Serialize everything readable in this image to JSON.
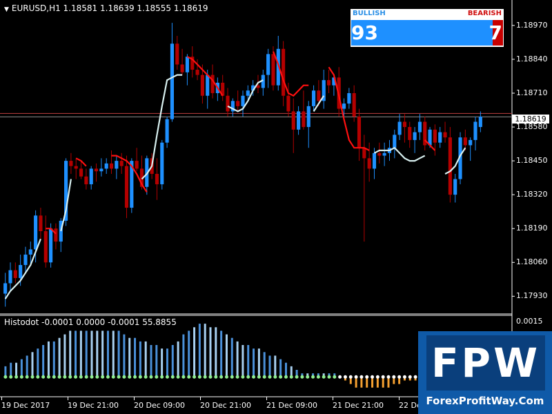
{
  "header": {
    "title": "EURUSD,H1  1.18581 1.18639 1.18555 1.18619"
  },
  "sub_window": {
    "title": "Histodot -0.0001 0.0000 -0.0001 55.8855",
    "ytick": "0.0015"
  },
  "y_axis": {
    "ticks": [
      "1.18970",
      "1.18840",
      "1.18710",
      "1.18580",
      "1.18450",
      "1.18320",
      "1.18190",
      "1.18060",
      "1.17930"
    ],
    "current_price": "1.18619"
  },
  "x_axis": {
    "ticks": [
      "19 Dec 2017",
      "19 Dec 21:00",
      "20 Dec 09:00",
      "20 Dec 21:00",
      "21 Dec 09:00",
      "21 Dec 21:00",
      "22 Dec"
    ]
  },
  "sentiment_panel": {
    "bullish_label": "BULLISH",
    "bearish_label": "BEARISH",
    "bullish_value": "93",
    "bearish_value": "7",
    "bullish_pct": 93,
    "bearish_pct": 7
  },
  "watermark": {
    "letters": "FPW",
    "url": "ForexProfitWay.Com"
  },
  "colors": {
    "background": "#000000",
    "bull_candle": "#1e90ff",
    "bear_candle": "#b40000",
    "line_up": "#d8f0f0",
    "line_down": "#ff1010",
    "histo_blue": "#4a90d9",
    "histo_light": "#a8d0f0",
    "histo_orange": "#f5a030",
    "dot_green": "#90ee90",
    "dot_white": "#ffffff",
    "grid_red": "#c04040"
  },
  "chart_data": {
    "type": "candlestick",
    "symbol": "EURUSD",
    "timeframe": "H1",
    "ylim": [
      1.1787,
      1.1902
    ],
    "ohlc": [
      [
        1.1794,
        1.1802,
        1.1789,
        1.1798
      ],
      [
        1.1798,
        1.1806,
        1.1795,
        1.1803
      ],
      [
        1.1803,
        1.1806,
        1.1798,
        1.18
      ],
      [
        1.18,
        1.1809,
        1.1797,
        1.1805
      ],
      [
        1.1805,
        1.1812,
        1.1802,
        1.1809
      ],
      [
        1.1809,
        1.1814,
        1.1805,
        1.1811
      ],
      [
        1.1811,
        1.1826,
        1.1806,
        1.1824
      ],
      [
        1.1824,
        1.1827,
        1.1815,
        1.1818
      ],
      [
        1.1818,
        1.1824,
        1.1804,
        1.1806
      ],
      [
        1.1806,
        1.1821,
        1.1804,
        1.1819
      ],
      [
        1.1819,
        1.1821,
        1.1811,
        1.1814
      ],
      [
        1.1814,
        1.1823,
        1.181,
        1.1822
      ],
      [
        1.1822,
        1.1846,
        1.182,
        1.1845
      ],
      [
        1.1845,
        1.1848,
        1.184,
        1.1843
      ],
      [
        1.1843,
        1.1846,
        1.1838,
        1.1842
      ],
      [
        1.1842,
        1.1845,
        1.1838,
        1.1839
      ],
      [
        1.1839,
        1.1842,
        1.1834,
        1.1836
      ],
      [
        1.1836,
        1.1843,
        1.1834,
        1.1842
      ],
      [
        1.1842,
        1.1844,
        1.1837,
        1.1841
      ],
      [
        1.1841,
        1.1846,
        1.1839,
        1.1842
      ],
      [
        1.1842,
        1.1846,
        1.184,
        1.1844
      ],
      [
        1.1844,
        1.1849,
        1.184,
        1.1842
      ],
      [
        1.1842,
        1.1847,
        1.1838,
        1.1845
      ],
      [
        1.1845,
        1.1848,
        1.184,
        1.1843
      ],
      [
        1.1843,
        1.1847,
        1.1823,
        1.1827
      ],
      [
        1.1827,
        1.1846,
        1.1825,
        1.1845
      ],
      [
        1.1845,
        1.185,
        1.1841,
        1.1842
      ],
      [
        1.1842,
        1.1847,
        1.1834,
        1.1835
      ],
      [
        1.1835,
        1.1847,
        1.1832,
        1.1846
      ],
      [
        1.1846,
        1.1848,
        1.1838,
        1.184
      ],
      [
        1.184,
        1.1846,
        1.183,
        1.1836
      ],
      [
        1.1836,
        1.1853,
        1.1834,
        1.1852
      ],
      [
        1.1852,
        1.1862,
        1.185,
        1.1861
      ],
      [
        1.1861,
        1.1898,
        1.186,
        1.189
      ],
      [
        1.189,
        1.1893,
        1.188,
        1.1882
      ],
      [
        1.1882,
        1.1888,
        1.1878,
        1.1879
      ],
      [
        1.1879,
        1.1886,
        1.1874,
        1.1885
      ],
      [
        1.1885,
        1.1889,
        1.1877,
        1.188
      ],
      [
        1.188,
        1.1884,
        1.1876,
        1.1878
      ],
      [
        1.1878,
        1.1882,
        1.1867,
        1.187
      ],
      [
        1.187,
        1.188,
        1.1865,
        1.1878
      ],
      [
        1.1878,
        1.1882,
        1.1869,
        1.1871
      ],
      [
        1.1871,
        1.1877,
        1.1868,
        1.1875
      ],
      [
        1.1875,
        1.1878,
        1.1868,
        1.187
      ],
      [
        1.187,
        1.1873,
        1.1862,
        1.1864
      ],
      [
        1.1864,
        1.1869,
        1.1862,
        1.1868
      ],
      [
        1.1868,
        1.1872,
        1.1864,
        1.1866
      ],
      [
        1.1866,
        1.1872,
        1.1862,
        1.187
      ],
      [
        1.187,
        1.1874,
        1.1868,
        1.1872
      ],
      [
        1.1872,
        1.1876,
        1.187,
        1.1874
      ],
      [
        1.1874,
        1.1878,
        1.1871,
        1.1873
      ],
      [
        1.1873,
        1.188,
        1.187,
        1.1878
      ],
      [
        1.1878,
        1.1888,
        1.1873,
        1.1886
      ],
      [
        1.1886,
        1.1889,
        1.1872,
        1.1874
      ],
      [
        1.1874,
        1.1893,
        1.1872,
        1.1888
      ],
      [
        1.1888,
        1.1891,
        1.1866,
        1.187
      ],
      [
        1.187,
        1.1875,
        1.1862,
        1.1864
      ],
      [
        1.1864,
        1.1869,
        1.1848,
        1.1857
      ],
      [
        1.1857,
        1.1866,
        1.1855,
        1.1864
      ],
      [
        1.1864,
        1.1872,
        1.1857,
        1.1858
      ],
      [
        1.1858,
        1.1868,
        1.185,
        1.1866
      ],
      [
        1.1866,
        1.1874,
        1.1864,
        1.1872
      ],
      [
        1.1872,
        1.1876,
        1.1866,
        1.1868
      ],
      [
        1.1868,
        1.188,
        1.1865,
        1.1876
      ],
      [
        1.1876,
        1.188,
        1.1871,
        1.1874
      ],
      [
        1.1874,
        1.1878,
        1.187,
        1.1877
      ],
      [
        1.1877,
        1.1881,
        1.1862,
        1.1865
      ],
      [
        1.1865,
        1.1869,
        1.1862,
        1.1867
      ],
      [
        1.1867,
        1.1873,
        1.1865,
        1.1871
      ],
      [
        1.1871,
        1.1874,
        1.186,
        1.1862
      ],
      [
        1.1862,
        1.1865,
        1.1845,
        1.185
      ],
      [
        1.185,
        1.1855,
        1.1814,
        1.1846
      ],
      [
        1.1846,
        1.1852,
        1.1837,
        1.1842
      ],
      [
        1.1842,
        1.185,
        1.1838,
        1.1848
      ],
      [
        1.1848,
        1.1852,
        1.1844,
        1.1847
      ],
      [
        1.1847,
        1.1852,
        1.1843,
        1.1848
      ],
      [
        1.1848,
        1.1853,
        1.1845,
        1.185
      ],
      [
        1.185,
        1.1857,
        1.1846,
        1.1855
      ],
      [
        1.1855,
        1.1863,
        1.1853,
        1.186
      ],
      [
        1.186,
        1.1863,
        1.1852,
        1.1858
      ],
      [
        1.1858,
        1.186,
        1.185,
        1.1853
      ],
      [
        1.1853,
        1.1858,
        1.1848,
        1.1856
      ],
      [
        1.1856,
        1.1863,
        1.1853,
        1.186
      ],
      [
        1.186,
        1.1862,
        1.1849,
        1.1851
      ],
      [
        1.1851,
        1.1858,
        1.185,
        1.1857
      ],
      [
        1.1857,
        1.1859,
        1.1847,
        1.1852
      ],
      [
        1.1852,
        1.1858,
        1.185,
        1.1856
      ],
      [
        1.1856,
        1.186,
        1.1852,
        1.1854
      ],
      [
        1.1854,
        1.1858,
        1.1829,
        1.1832
      ],
      [
        1.1832,
        1.184,
        1.1829,
        1.1838
      ],
      [
        1.1838,
        1.1856,
        1.1836,
        1.1854
      ],
      [
        1.1854,
        1.1857,
        1.1849,
        1.1851
      ],
      [
        1.1851,
        1.1854,
        1.1845,
        1.1853
      ],
      [
        1.1853,
        1.1862,
        1.1849,
        1.186
      ],
      [
        1.1858,
        1.1864,
        1.1856,
        1.1862
      ]
    ],
    "trend_line": [
      {
        "color": "down",
        "y": [
          null,
          null,
          null,
          null,
          null,
          null,
          null,
          null,
          1.1819,
          1.1819,
          1.1817,
          null,
          null,
          null,
          1.1846,
          1.1845,
          1.1843,
          null,
          null,
          null,
          null,
          1.1847,
          1.1847,
          1.1846,
          1.1845,
          1.1843,
          1.184,
          1.1836,
          1.1833,
          null,
          null,
          null,
          null,
          null,
          null,
          null,
          1.1885,
          1.1884,
          1.1882,
          1.188,
          1.1878,
          1.1876,
          1.1873,
          1.187,
          null,
          null,
          null,
          null,
          null,
          null,
          null,
          null,
          null,
          1.1887,
          1.1882,
          1.1876,
          1.1871,
          1.187,
          1.1872,
          1.1874,
          1.1874,
          null,
          null,
          null,
          1.1881,
          1.1878,
          1.187,
          1.1861,
          1.1853,
          1.185,
          1.185,
          1.185,
          1.1849,
          null,
          null,
          null,
          null,
          null,
          null,
          null,
          null,
          null,
          null,
          1.1853,
          1.1851,
          1.1849,
          null,
          null,
          null,
          null
        ]
      },
      {
        "color": "up",
        "y": [
          1.1792,
          1.1795,
          1.1797,
          1.1799,
          1.1802,
          1.1805,
          1.181,
          1.1815,
          null,
          null,
          null,
          1.1818,
          1.1826,
          1.1838,
          null,
          null,
          null,
          null,
          null,
          null,
          null,
          null,
          null,
          null,
          null,
          null,
          null,
          1.1838,
          1.184,
          1.1843,
          1.1855,
          1.1866,
          1.1876,
          1.1877,
          1.1878,
          1.1878,
          null,
          null,
          null,
          null,
          null,
          null,
          null,
          null,
          1.1866,
          1.1865,
          1.1864,
          1.1865,
          1.1868,
          1.1872,
          1.1875,
          1.1876,
          null,
          null,
          null,
          null,
          null,
          null,
          null,
          null,
          null,
          1.1864,
          1.1867,
          1.187,
          null,
          null,
          null,
          null,
          null,
          null,
          null,
          null,
          null,
          1.1848,
          1.1849,
          1.1849,
          1.1849,
          1.185,
          1.1848,
          1.1846,
          1.1845,
          1.1845,
          1.1846,
          1.1847,
          null,
          null,
          null,
          1.184,
          1.1841,
          1.1843,
          1.1847,
          1.185
        ]
      }
    ],
    "histodot": {
      "values": [
        0.0003,
        0.0004,
        0.0004,
        0.0005,
        0.0006,
        0.0007,
        0.0008,
        0.0009,
        0.001,
        0.001,
        0.0011,
        0.0012,
        0.0013,
        0.0013,
        0.0013,
        0.0013,
        0.0013,
        0.0013,
        0.0013,
        0.0013,
        0.0013,
        0.0013,
        0.0012,
        0.0011,
        0.0011,
        0.001,
        0.001,
        0.0009,
        0.0009,
        0.0008,
        0.0008,
        0.0009,
        0.001,
        0.0012,
        0.0013,
        0.0014,
        0.0015,
        0.0015,
        0.0014,
        0.0014,
        0.0013,
        0.0012,
        0.0011,
        0.001,
        0.0009,
        0.0009,
        0.0008,
        0.0008,
        0.0007,
        0.0006,
        0.0006,
        0.0005,
        0.0004,
        0.0003,
        0.0002,
        0.0001,
        0.0001,
        0.0001,
        0.0001,
        0.0001,
        0.0001,
        0.0001,
        0.0,
        -0.0001,
        -0.0002,
        -0.0003,
        -0.0003,
        -0.0003,
        -0.0003,
        -0.0003,
        -0.0003,
        -0.0003,
        -0.0002,
        -0.0002,
        -0.0001,
        -0.0001,
        -0.0001
      ],
      "ylim": [
        -0.0005,
        0.0016
      ]
    }
  }
}
